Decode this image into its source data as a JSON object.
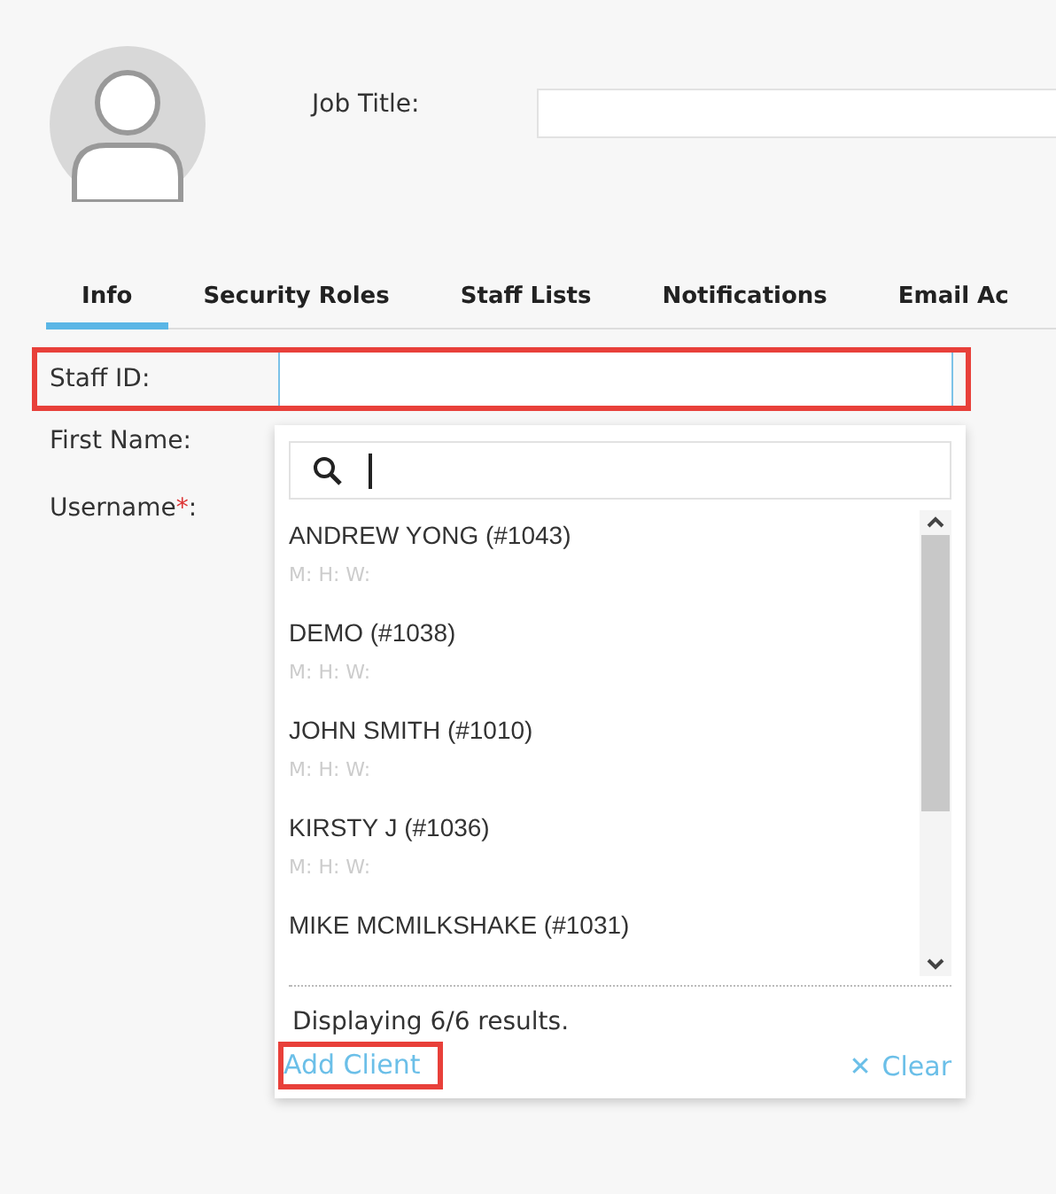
{
  "profile": {
    "job_title_label": "Job Title:"
  },
  "tabs": [
    {
      "label": "Info",
      "selected": true
    },
    {
      "label": "Security Roles",
      "selected": false
    },
    {
      "label": "Staff Lists",
      "selected": false
    },
    {
      "label": "Notifications",
      "selected": false
    },
    {
      "label": "Email Ac",
      "selected": false
    }
  ],
  "fields": [
    {
      "label": "Staff ID:",
      "highlighted": true
    },
    {
      "label": "First Name:",
      "highlighted": false
    },
    {
      "label": "Username",
      "required_mark": "*",
      "suffix": ":",
      "highlighted": false
    }
  ],
  "dropdown": {
    "results": [
      {
        "name": "ANDREW YONG (#1043)",
        "details": "M: H: W:"
      },
      {
        "name": "DEMO (#1038)",
        "details": "M: H: W:"
      },
      {
        "name": "JOHN SMITH (#1010)",
        "details": "M: H: W:"
      },
      {
        "name": "KIRSTY J (#1036)",
        "details": "M: H: W:"
      },
      {
        "name": "MIKE MCMILKSHAKE (#1031)"
      }
    ],
    "summary": "Displaying 6/6 results.",
    "add_link": {
      "label": "Add Client",
      "highlighted": true
    },
    "clear_icon": "✕",
    "clear_label": "Clear"
  }
}
